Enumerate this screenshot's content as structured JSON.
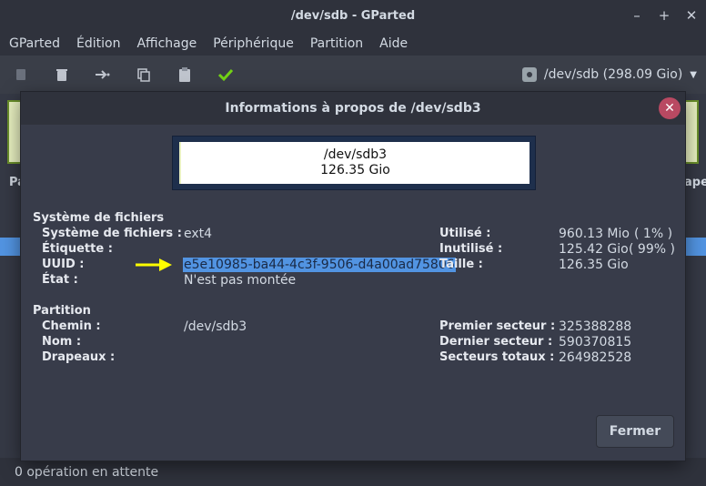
{
  "window": {
    "title": "/dev/sdb - GParted",
    "controls": [
      "–",
      "+",
      "✕"
    ]
  },
  "menubar": [
    "GParted",
    "Édition",
    "Affichage",
    "Périphérique",
    "Partition",
    "Aide"
  ],
  "toolbar": {
    "icons": [
      "new-partition-icon",
      "delete-icon",
      "resize-move-icon",
      "copy-icon",
      "paste-icon",
      "apply-check-icon"
    ],
    "device_selector": "/dev/sdb (298.09 Gio)",
    "accent_green": "#73d216"
  },
  "background": {
    "left_col_label": "Pa",
    "right_col_label": "ape"
  },
  "statusbar": {
    "text": "0 opération en attente"
  },
  "dialog": {
    "title": "Informations à propos de /dev/sdb3",
    "close_icon": "close-icon",
    "partition_graphic": {
      "name": "/dev/sdb3",
      "size": "126.35 Gio"
    },
    "filesystem": {
      "heading": "Système de fichiers",
      "fs_label": "Système de fichiers :",
      "fs_value": "ext4",
      "label_label": "Étiquette :",
      "label_value": "",
      "uuid_label": "UUID :",
      "uuid_value": "e5e10985-ba44-4c3f-9506-d4a00ad75806",
      "state_label": "État :",
      "state_value": "N'est pas montée",
      "used_label": "Utilisé :",
      "used_value": "960.13 Mio",
      "used_pct": "( 1% )",
      "unused_label": "Inutilisé :",
      "unused_value": "125.42 Gio",
      "unused_pct": "( 99% )",
      "size_label": "Taille :",
      "size_value": "126.35 Gio"
    },
    "partition": {
      "heading": "Partition",
      "path_label": "Chemin :",
      "path_value": "/dev/sdb3",
      "name_label": "Nom :",
      "name_value": "",
      "flags_label": "Drapeaux :",
      "flags_value": "",
      "first_sector_label": "Premier secteur :",
      "first_sector_value": "325388288",
      "last_sector_label": "Dernier secteur :",
      "last_sector_value": "590370815",
      "total_sectors_label": "Secteurs totaux :",
      "total_sectors_value": "264982528"
    },
    "close_button": "Fermer",
    "annotation_arrow_color": "#ffff00",
    "uuid_highlight_color": "#5294e2"
  }
}
